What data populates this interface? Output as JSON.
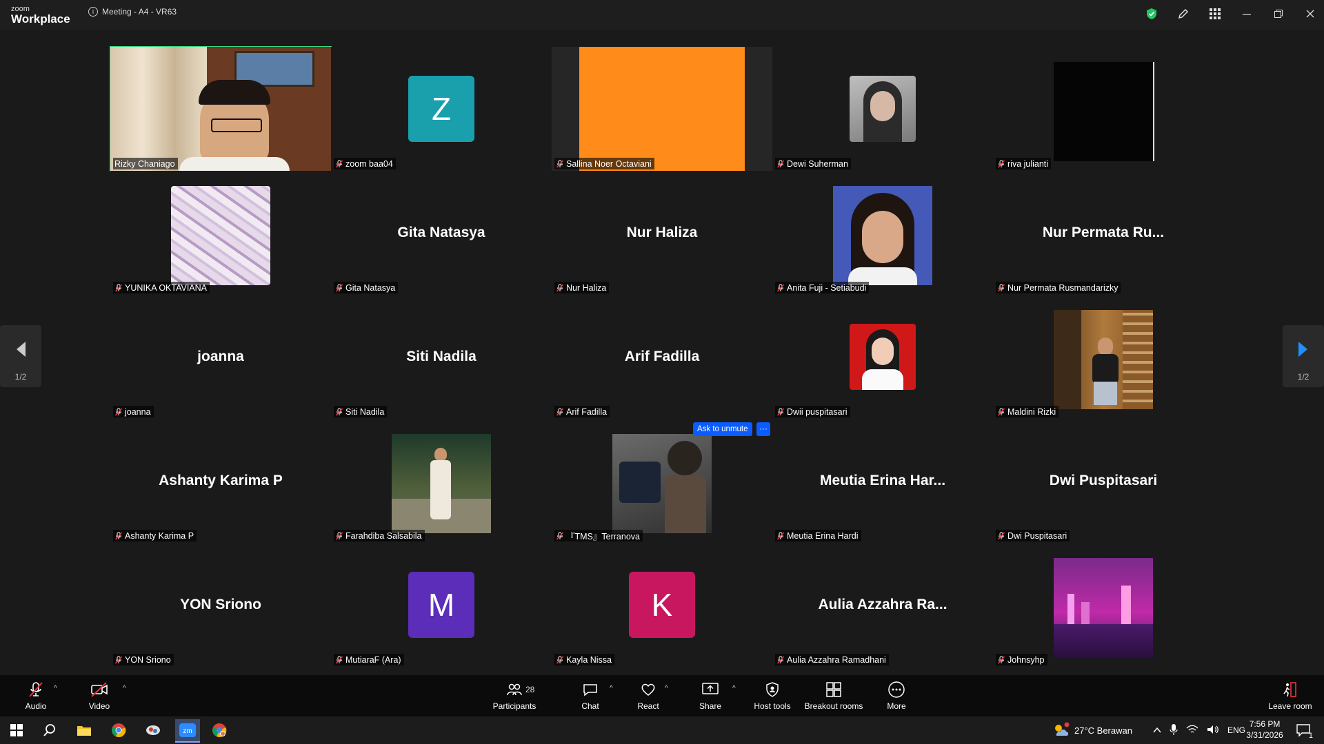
{
  "app": {
    "logo_small": "zoom",
    "logo_big": "Workplace",
    "meeting_title": "Meeting - A4 - VR63"
  },
  "titlebar_icons": [
    "shield-check-icon",
    "pencil-icon",
    "apps-grid-icon",
    "minimize-icon",
    "restore-icon",
    "close-icon"
  ],
  "participants": [
    {
      "label": "Rizky Chaniago",
      "kind": "video",
      "muted": false,
      "active": true
    },
    {
      "label": "zoom baa04",
      "kind": "letter",
      "letter": "Z",
      "color": "#1aa0ad",
      "muted": true
    },
    {
      "label": "Sallina Noer Octaviani",
      "kind": "orange",
      "muted": true
    },
    {
      "label": "Dewi Suherman",
      "kind": "photo96",
      "muted": true
    },
    {
      "label": "riva julianti",
      "kind": "black",
      "muted": true
    },
    {
      "label": "YUNIKA OKTAVIANA",
      "kind": "marble",
      "muted": true
    },
    {
      "label": "Gita Natasya",
      "kind": "name",
      "bigname": "Gita Natasya",
      "muted": true
    },
    {
      "label": "Nur Haliza",
      "kind": "name",
      "bigname": "Nur Haliza",
      "muted": true
    },
    {
      "label": "Anita Fuji - Setiabudi",
      "kind": "photo144",
      "muted": true
    },
    {
      "label": "Nur Permata Rusmandarizky",
      "kind": "name",
      "bigname": "Nur Permata Ru...",
      "muted": true
    },
    {
      "label": "joanna",
      "kind": "name",
      "bigname": "joanna",
      "muted": true
    },
    {
      "label": "Siti Nadila",
      "kind": "name",
      "bigname": "Siti Nadila",
      "muted": true
    },
    {
      "label": "Arif Fadilla",
      "kind": "name",
      "bigname": "Arif Fadilla",
      "muted": true
    },
    {
      "label": "Dwii puspitasari",
      "kind": "redphoto",
      "muted": true
    },
    {
      "label": "Maldini Rizki",
      "kind": "photo144b",
      "muted": true
    },
    {
      "label": "Ashanty Karima P",
      "kind": "name",
      "bigname": "Ashanty Karima P",
      "muted": true
    },
    {
      "label": "Farahdiba Salsabila",
      "kind": "photo144c",
      "muted": true
    },
    {
      "label": "『TMS』Terranova",
      "kind": "photo144d",
      "muted": true
    },
    {
      "label": "Meutia Erina Hardi",
      "kind": "name",
      "bigname": "Meutia Erina Har...",
      "muted": true
    },
    {
      "label": "Dwi Puspitasari",
      "kind": "name",
      "bigname": "Dwi Puspitasari",
      "muted": true
    },
    {
      "label": "YON Sriono",
      "kind": "name",
      "bigname": "YON Sriono",
      "muted": true
    },
    {
      "label": "MutiaraF (Ara)",
      "kind": "letter",
      "letter": "M",
      "color": "#5b2db8",
      "muted": true
    },
    {
      "label": "Kayla Nissa",
      "kind": "letter",
      "letter": "K",
      "color": "#c8175f",
      "muted": true
    },
    {
      "label": "Aulia Azzahra Ramadhani",
      "kind": "name",
      "bigname": "Aulia Azzahra Ra...",
      "muted": true
    },
    {
      "label": "Johnsyhp",
      "kind": "city",
      "muted": true
    }
  ],
  "page_indicator": "1/2",
  "hover_actions": {
    "ask_unmute": "Ask to unmute",
    "more": "···"
  },
  "toolbar": {
    "audio": "Audio",
    "video": "Video",
    "participants": "Participants",
    "participants_count": "28",
    "chat": "Chat",
    "react": "React",
    "share": "Share",
    "host_tools": "Host tools",
    "breakout": "Breakout rooms",
    "more": "More",
    "leave": "Leave room"
  },
  "taskbar": {
    "weather": "27°C  Berawan",
    "lang": "ENG",
    "time": "7:56 PM",
    "date": "3/31/2026",
    "notif": "1"
  },
  "colors": {
    "active_border": "#3ddc84",
    "accent_blue": "#0b5cff",
    "mute_red": "#e8383d"
  }
}
